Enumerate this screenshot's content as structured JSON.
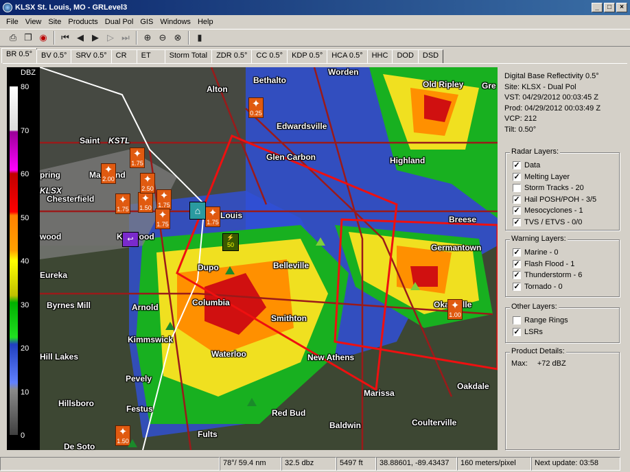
{
  "window": {
    "title": "KLSX St. Louis, MO - GRLevel3"
  },
  "menu": [
    "File",
    "View",
    "Site",
    "Products",
    "Dual Pol",
    "GIS",
    "Windows",
    "Help"
  ],
  "tabs": [
    "BR 0.5°",
    "BV 0.5°",
    "SRV 0.5°",
    "CR",
    "ET",
    "Storm Total",
    "ZDR 0.5°",
    "CC 0.5°",
    "KDP 0.5°",
    "HCA 0.5°",
    "HHC",
    "DOD",
    "DSD"
  ],
  "legend": {
    "units": "DBZ",
    "ticks": [
      "80",
      "70",
      "60",
      "50",
      "40",
      "30",
      "20",
      "10",
      "0"
    ]
  },
  "info": {
    "product": "Digital Base Reflectivity 0.5°",
    "site": "Site:  KLSX - Dual Pol",
    "vst": "VST:  04/29/2012  00:03:45 Z",
    "prod": "Prod: 04/29/2012  00:03:49 Z",
    "vcp": "VCP:  212",
    "tilt": "Tilt:  0.50°"
  },
  "radar_layers": {
    "title": "Radar Layers:",
    "items": [
      {
        "label": "Data",
        "checked": true
      },
      {
        "label": "Melting Layer",
        "checked": true
      },
      {
        "label": "Storm Tracks - 20",
        "checked": false
      },
      {
        "label": "Hail POSH/POH - 3/5",
        "checked": true
      },
      {
        "label": "Mesocyclones - 1",
        "checked": true
      },
      {
        "label": "TVS / ETVS - 0/0",
        "checked": true
      }
    ]
  },
  "warning_layers": {
    "title": "Warning Layers:",
    "items": [
      {
        "label": "Marine - 0",
        "checked": true
      },
      {
        "label": "Flash Flood - 1",
        "checked": true
      },
      {
        "label": "Thunderstorm - 6",
        "checked": true
      },
      {
        "label": "Tornado - 0",
        "checked": true
      }
    ]
  },
  "other_layers": {
    "title": "Other Layers:",
    "items": [
      {
        "label": "Range Rings",
        "checked": false
      },
      {
        "label": "LSRs",
        "checked": true
      }
    ]
  },
  "product_details": {
    "title": "Product Details:",
    "max_label": "Max:",
    "max_value": "+72 dBZ"
  },
  "status": {
    "azimuth": "78°/ 59.4 nm",
    "dbz": "32.5 dbz",
    "height": "5497 ft",
    "coords": "38.88601, -89.43437",
    "resolution": "160 meters/pixel",
    "next_update": "Next update: 03:58"
  },
  "map_labels": [
    "Worden",
    "Alton",
    "Bethalto",
    "Old Ripley",
    "Gre",
    "Edwardsville",
    "Saint",
    "KSTL",
    "Glen Carbon",
    "Highland",
    "pring",
    "Maryland",
    "KLSX",
    "Chesterfield",
    "Louis",
    "Breese",
    "Germantown",
    "wood",
    "Kirkwood",
    "Belleville",
    "Dupo",
    "Eureka",
    "Byrnes Mill",
    "Arnold",
    "Columbia",
    "Okawville",
    "Smithton",
    "Kimmswick",
    "Hill Lakes",
    "Waterloo",
    "New Athens",
    "Pevely",
    "Oakdale",
    "Hillsboro",
    "Marissa",
    "Festus",
    "Red Bud",
    "Coulterville",
    "Fults",
    "Baldwin",
    "De Soto"
  ],
  "hail_values": [
    "0.25",
    "2.00",
    "1.75",
    "1.50",
    "2.50",
    "1.75",
    "1.75",
    "1.75",
    "1.75",
    "1.00",
    "1.50"
  ],
  "warning_marker": "50"
}
